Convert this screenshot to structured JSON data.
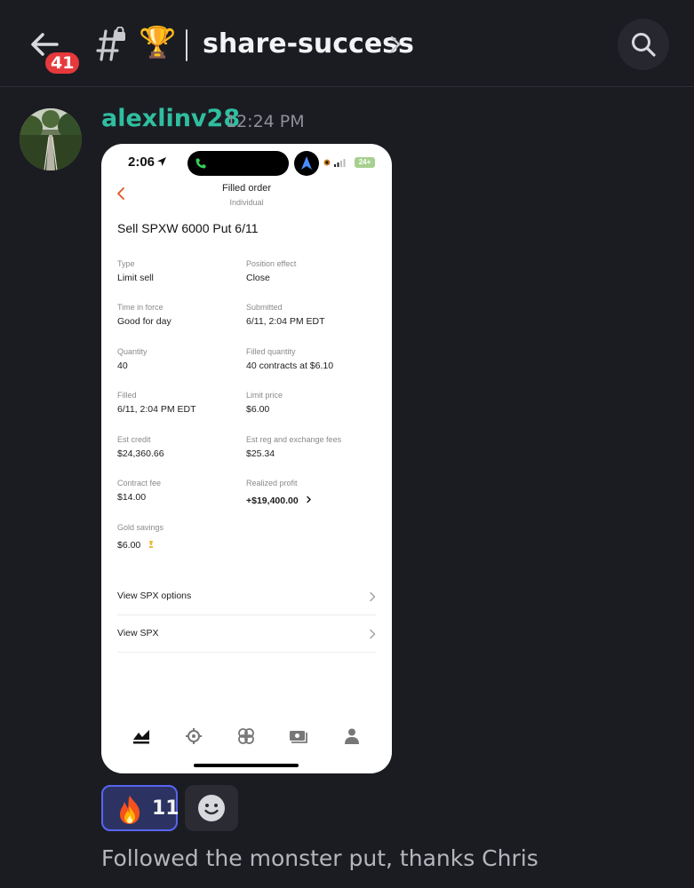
{
  "header": {
    "unread_count": "41",
    "channel_emoji": "🏆",
    "channel_name": "share-success",
    "back_icon": "arrow-left-icon",
    "channel_icon": "locked-text-channel-icon",
    "search_icon": "search-icon"
  },
  "message": {
    "author": "alexlinv28",
    "time": "12:24 PM",
    "text": "Followed the monster put, thanks Chris",
    "author_color": "#2fbfa0",
    "attachment": {
      "status_bar": {
        "time": "2:06",
        "battery": "24+"
      },
      "title": "Filled order",
      "subtitle": "Individual",
      "heading": "Sell SPXW 6000 Put 6/11",
      "fields": [
        {
          "label": "Type",
          "value": "Limit sell"
        },
        {
          "label": "Position effect",
          "value": "Close"
        },
        {
          "label": "Time in force",
          "value": "Good for day"
        },
        {
          "label": "Submitted",
          "value": "6/11, 2:04 PM EDT"
        },
        {
          "label": "Quantity",
          "value": "40"
        },
        {
          "label": "Filled quantity",
          "value": "40 contracts at $6.10"
        },
        {
          "label": "Filled",
          "value": "6/11, 2:04 PM EDT"
        },
        {
          "label": "Limit price",
          "value": "$6.00"
        },
        {
          "label": "Est credit",
          "value": "$24,360.66"
        },
        {
          "label": "Est reg and exchange fees",
          "value": "$25.34"
        },
        {
          "label": "Contract fee",
          "value": "$14.00"
        },
        {
          "label": "Realized profit",
          "value": "+$19,400.00"
        },
        {
          "label": "Gold savings",
          "value": "$6.00"
        }
      ],
      "links": [
        {
          "label": "View SPX options"
        },
        {
          "label": "View SPX"
        }
      ],
      "tabbar": [
        "investing-chart-icon",
        "crypto-icon",
        "retirement-icon",
        "cash-card-icon",
        "account-person-icon"
      ]
    }
  },
  "reactions": [
    {
      "emoji": "🔥",
      "count": "11",
      "icon": "fire-icon"
    }
  ],
  "add_reaction_icon": "add-reaction-smiley-icon"
}
